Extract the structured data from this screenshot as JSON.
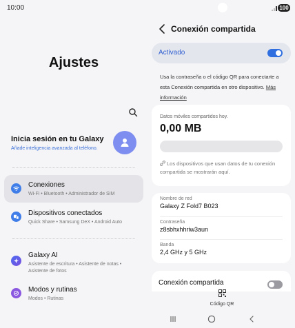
{
  "status_bar": {
    "time": "10:00",
    "battery": "100"
  },
  "left_pane": {
    "title": "Ajustes",
    "account": {
      "title": "Inicia sesión en tu Galaxy",
      "subtitle": "Añade inteligencia avanzada al teléfono."
    },
    "menu": [
      {
        "label": "Conexiones",
        "sub": "Wi-Fi  •  Bluetooth  •  Administrador de SIM",
        "icon": "wifi-icon",
        "color": "#3f7ee8",
        "active": true
      },
      {
        "label": "Dispositivos conectados",
        "sub": "Quick Share  •  Samsung DeX  •  Android Auto",
        "icon": "devices-icon",
        "color": "#3f7ee8",
        "active": false
      },
      {
        "label": "Galaxy AI",
        "sub": "Asistente de escritura  •  Asistente de notas  •  Asistente de fotos",
        "icon": "sparkle-icon",
        "color": "#6a5ce0",
        "active": false
      },
      {
        "label": "Modos y rutinas",
        "sub": "Modos  •  Rutinas",
        "icon": "check-circle-icon",
        "color": "#8a58e0",
        "active": false
      }
    ]
  },
  "right_pane": {
    "title": "Conexión compartida",
    "toggle": {
      "label": "Activado",
      "on": true
    },
    "info": {
      "text": "Usa la contraseña o el código QR para conectarte a esta Conexión compartida en otro dispositivo. ",
      "link": "Más información"
    },
    "data_card": {
      "caption": "Datos móviles compartidos hoy.",
      "value": "0,00 MB",
      "progress": 0,
      "note": "Los dispositivos que usan datos de tu conexión compartida se mostrarán aquí."
    },
    "network": {
      "name_label": "Nombre de red",
      "name_value": "Galaxy Z Fold7 B023",
      "password_label": "Contraseña",
      "password_value": "z8sbhxhhriw3aun",
      "band_label": "Banda",
      "band_value": "2,4 GHz y 5 GHz"
    },
    "share_row": {
      "label": "Conexión compartida",
      "on": false
    },
    "qr": {
      "label": "Código QR"
    }
  },
  "colors": {
    "accent": "#2f6fe0",
    "link": "#3a6fd8",
    "avatar": "#7e8ef0"
  }
}
